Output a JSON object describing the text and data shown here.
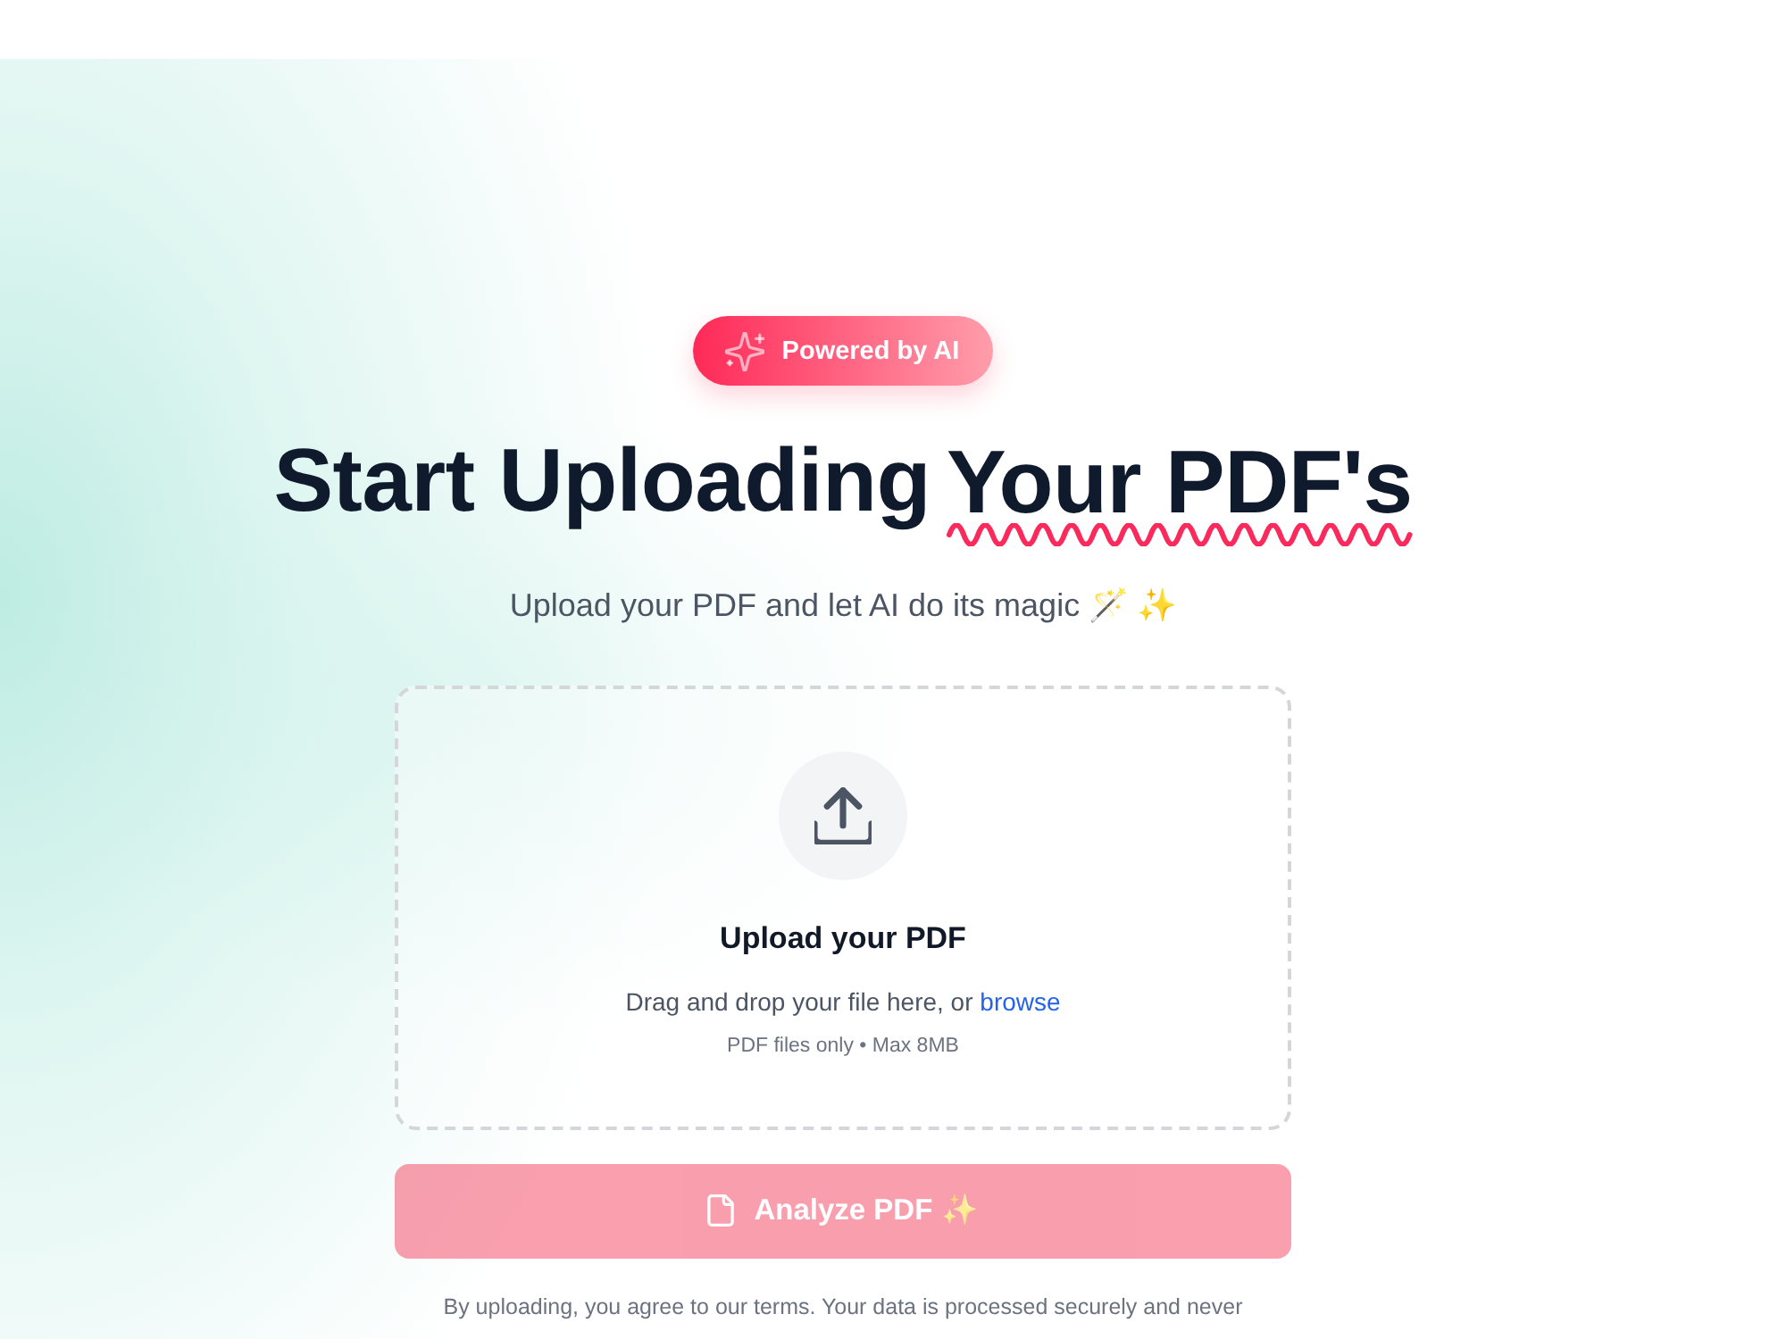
{
  "badge": {
    "label": "Powered by AI"
  },
  "heading": {
    "text": "Start Uploading",
    "highlight": "Your PDF's"
  },
  "subtitle": "Upload your PDF and let AI do its magic 🪄 ✨",
  "dropzone": {
    "title": "Upload your PDF",
    "hint": "Drag and drop your file here, or",
    "link": "browse",
    "limits": "PDF files only • Max 8MB"
  },
  "analyze_button": {
    "label": "Analyze PDF ✨",
    "disabled": true
  },
  "footer_note": "By uploading, you agree to our terms. Your data is processed securely and never"
}
